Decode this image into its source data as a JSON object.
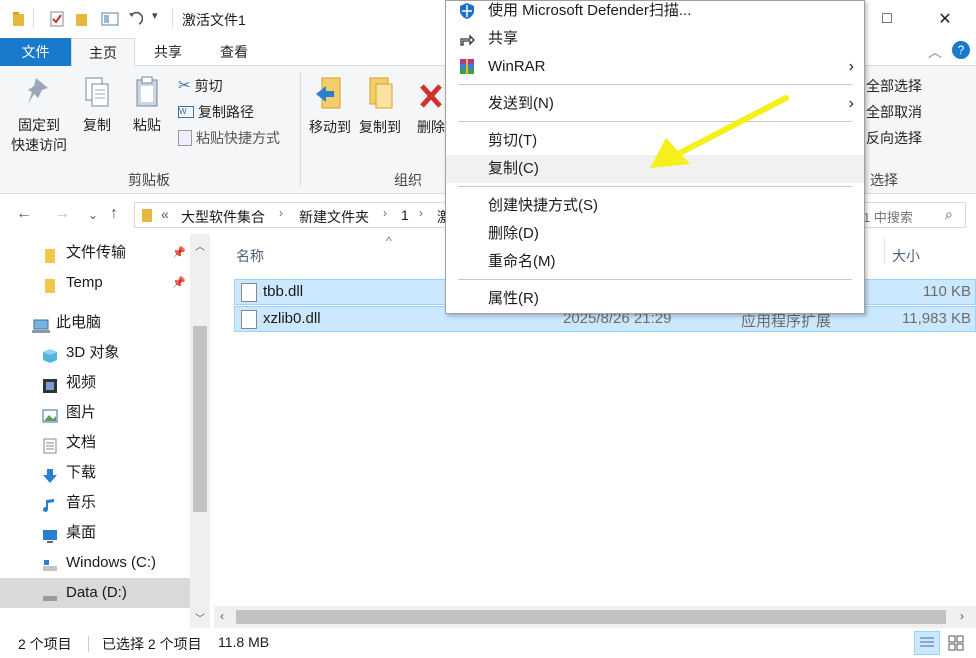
{
  "window": {
    "title": "激活文件1",
    "controls": {
      "maximize": "□",
      "close": "✕"
    }
  },
  "ribbon": {
    "tabs": {
      "file": "文件",
      "home": "主页",
      "share": "共享",
      "view": "查看"
    },
    "clipboard": {
      "pin_line1": "固定到",
      "pin_line2": "快速访问",
      "copy": "复制",
      "paste": "粘贴",
      "cut": "剪切",
      "copy_path": "复制路径",
      "paste_shortcut": "粘贴快捷方式",
      "group_label": "剪贴板"
    },
    "organize": {
      "move_to": "移动到",
      "copy_to": "复制到",
      "delete": "删除",
      "group_label": "组织"
    },
    "select": {
      "select_all": "全部选择",
      "select_none": "全部取消",
      "invert": "反向选择",
      "group_label": "选择"
    }
  },
  "address": {
    "prefix": "«",
    "crumbs": [
      "大型软件集合",
      "新建文件夹",
      "1",
      "激"
    ],
    "search_placeholder": "1 中搜索"
  },
  "nav": {
    "items": [
      {
        "label": "文件传输",
        "icon": "folder-icon",
        "pinned": true
      },
      {
        "label": "Temp",
        "icon": "folder-icon",
        "pinned": true
      },
      {
        "label": "此电脑",
        "icon": "computer-icon"
      },
      {
        "label": "3D 对象",
        "icon": "cube-icon"
      },
      {
        "label": "视频",
        "icon": "video-icon"
      },
      {
        "label": "图片",
        "icon": "picture-icon"
      },
      {
        "label": "文档",
        "icon": "document-icon"
      },
      {
        "label": "下载",
        "icon": "download-icon"
      },
      {
        "label": "音乐",
        "icon": "music-icon"
      },
      {
        "label": "桌面",
        "icon": "desktop-icon"
      },
      {
        "label": "Windows (C:)",
        "icon": "drive-icon"
      },
      {
        "label": "Data (D:)",
        "icon": "drive-icon",
        "selected": true
      }
    ]
  },
  "filelist": {
    "columns": {
      "name": "名称",
      "size": "大小"
    },
    "files": [
      {
        "name": "tbb.dll",
        "date": "",
        "type": "",
        "size": "110 KB"
      },
      {
        "name": "xzlib0.dll",
        "date": "2025/8/26 21:29",
        "type": "应用程序扩展",
        "size": "11,983 KB"
      }
    ]
  },
  "status": {
    "count": "2 个项目",
    "selected": "已选择 2 个项目",
    "size": "11.8 MB"
  },
  "context_menu": {
    "items": [
      {
        "id": "defender",
        "label": "使用 Microsoft Defender扫描...",
        "icon": "shield-icon"
      },
      {
        "id": "share",
        "label": "共享",
        "icon": "share-icon"
      },
      {
        "id": "winrar",
        "label": "WinRAR",
        "icon": "winrar-icon",
        "submenu": true
      },
      {
        "id": "sendto",
        "label": "发送到(N)",
        "submenu": true
      },
      {
        "id": "cut",
        "label": "剪切(T)"
      },
      {
        "id": "copy",
        "label": "复制(C)",
        "highlighted": true
      },
      {
        "id": "shortcut",
        "label": "创建快捷方式(S)"
      },
      {
        "id": "delete",
        "label": "删除(D)"
      },
      {
        "id": "rename",
        "label": "重命名(M)"
      },
      {
        "id": "properties",
        "label": "属性(R)"
      }
    ]
  },
  "colors": {
    "accent": "#1979ca",
    "selection": "#cce8ff",
    "annotation_arrow": "#f5ef1c"
  }
}
